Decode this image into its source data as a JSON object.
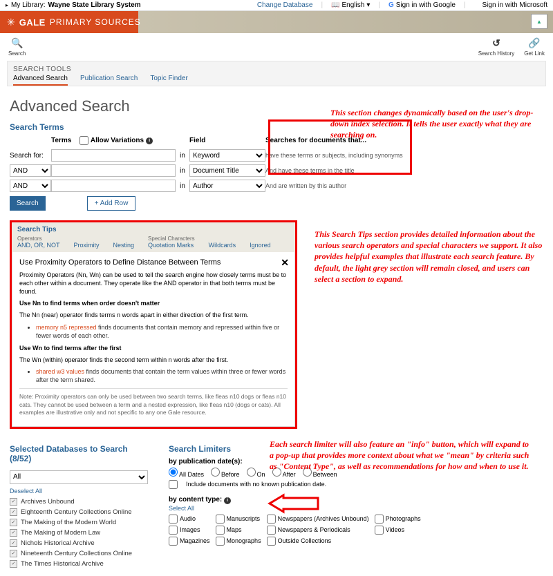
{
  "topbar": {
    "library_label": "My Library:",
    "library_name": "Wayne State Library System",
    "change_db": "Change Database",
    "lang": "English",
    "google": "Sign in with Google",
    "microsoft": "Sign in with Microsoft"
  },
  "brand": {
    "gale": "GALE",
    "ps": "PRIMARY SOURCES"
  },
  "toolbar": {
    "search": "Search",
    "history": "Search History",
    "getlink": "Get Link"
  },
  "tabs": {
    "title": "SEARCH TOOLS",
    "advanced": "Advanced Search",
    "publication": "Publication Search",
    "topic": "Topic Finder"
  },
  "page_title": "Advanced Search",
  "terms": {
    "heading": "Search Terms",
    "col_terms": "Terms",
    "allow_variations": "Allow Variations",
    "col_field": "Field",
    "col_explain": "Searches for documents that...",
    "search_for": "Search for:",
    "in": "in",
    "ops": [
      "AND",
      "AND"
    ],
    "fields": [
      "Keyword",
      "Document Title",
      "Author"
    ],
    "explains": [
      "have these terms or subjects, including synonyms",
      "And have these terms in the title",
      "And are written by this author"
    ],
    "search_btn": "Search",
    "add_row": "+ Add Row"
  },
  "tips": {
    "header": "Search Tips",
    "cat_operators_lbl": "Operators",
    "cat_operators": "AND, OR, NOT",
    "cat_prox": "Proximity",
    "cat_nest": "Nesting",
    "cat_special_lbl": "Special Characters",
    "cat_quot": "Quotation Marks",
    "cat_wild": "Wildcards",
    "cat_ign": "Ignored",
    "body_title": "Use Proximity Operators to Define Distance Between Terms",
    "p1": "Proximity Operators (Nn, Wn) can be used to tell the search engine how closely terms must be to each other within a document. They operate like the AND operator in that both terms must be found.",
    "sub1": "Use Nn to find terms when order doesn't matter",
    "p2": "The Nn (near) operator finds terms n words apart in either direction of the first term.",
    "ex1a": "memory n5 repressed",
    "ex1b": " finds documents that contain memory and repressed within five or fewer words of each other.",
    "sub2": "Use Wn to find terms after the first",
    "p3": "The Wn (within) operator finds the second term within n words after the first.",
    "ex2a": "shared w3 values",
    "ex2b": " finds documents that contain the term values within three or fewer words after the term shared.",
    "note": "Note: Proximity operators can only be used between two search terms, like fleas n10 dogs or fleas n10 cats. They cannot be used between a term and a nested expression, like fleas n10 (dogs or cats). All examples are illustrative only and not specific to any one Gale resource."
  },
  "annotations": {
    "a1": "This section changes dynamically based on the user's drop-down index selection. It tells the user exactly what they are searching on.",
    "a2": "This Search Tips section provides detailed information about the various search operators and special characters we support. It also provides helpful examples that illustrate each search feature. By default, the light grey section will remain closed, and users can select a section to expand.",
    "a3": "Each search limiter will also feature an \"info\" button, which will expand to a pop-up that provides more context about what we \"mean\" by criteria such as \"Content Type\", as well as recommendations for how and when to use it."
  },
  "databases": {
    "heading": "Selected Databases to Search (8/52)",
    "all": "All",
    "deselect": "Deselect All",
    "items": [
      "Archives Unbound",
      "Eighteenth Century Collections Online",
      "The Making of the Modern World",
      "The Making of Modern Law",
      "Nichols Historical Archive",
      "Nineteenth Century Collections Online",
      "The Times Historical Archive"
    ]
  },
  "limiters": {
    "heading": "Search Limiters",
    "pub_date": "by publication date(s):",
    "dates": [
      "All Dates",
      "Before",
      "On",
      "After",
      "Between"
    ],
    "include_unknown": "Include documents with no known publication date.",
    "content_type": "by content type:",
    "select_all": "Select All",
    "types": [
      "Audio",
      "Manuscripts",
      "Newspapers (Archives Unbound)",
      "Photographs",
      "Images",
      "Maps",
      "Newspapers & Periodicals",
      "Videos",
      "Magazines",
      "Monographs",
      "Outside Collections",
      ""
    ]
  }
}
